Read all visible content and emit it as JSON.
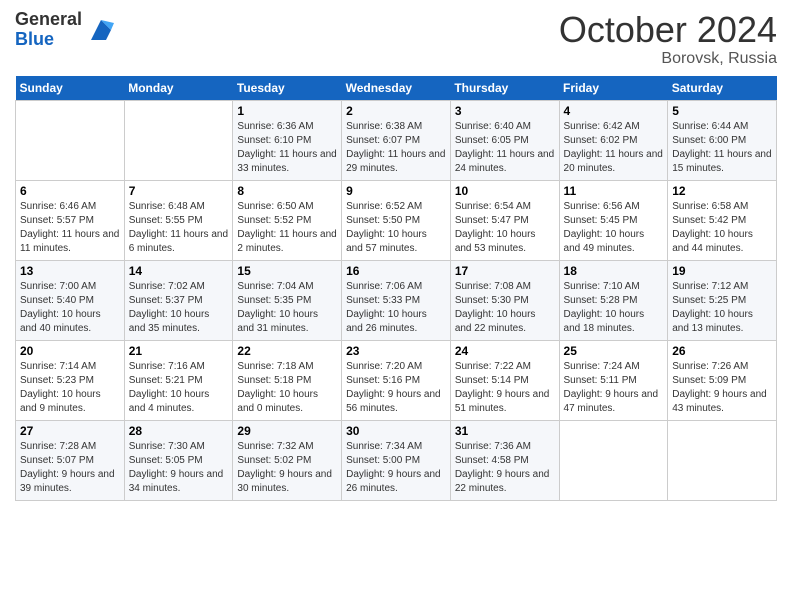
{
  "logo": {
    "line1": "General",
    "line2": "Blue"
  },
  "title": "October 2024",
  "location": "Borovsk, Russia",
  "days_header": [
    "Sunday",
    "Monday",
    "Tuesday",
    "Wednesday",
    "Thursday",
    "Friday",
    "Saturday"
  ],
  "weeks": [
    [
      {
        "num": "",
        "sunrise": "",
        "sunset": "",
        "daylight": ""
      },
      {
        "num": "",
        "sunrise": "",
        "sunset": "",
        "daylight": ""
      },
      {
        "num": "1",
        "sunrise": "Sunrise: 6:36 AM",
        "sunset": "Sunset: 6:10 PM",
        "daylight": "Daylight: 11 hours and 33 minutes."
      },
      {
        "num": "2",
        "sunrise": "Sunrise: 6:38 AM",
        "sunset": "Sunset: 6:07 PM",
        "daylight": "Daylight: 11 hours and 29 minutes."
      },
      {
        "num": "3",
        "sunrise": "Sunrise: 6:40 AM",
        "sunset": "Sunset: 6:05 PM",
        "daylight": "Daylight: 11 hours and 24 minutes."
      },
      {
        "num": "4",
        "sunrise": "Sunrise: 6:42 AM",
        "sunset": "Sunset: 6:02 PM",
        "daylight": "Daylight: 11 hours and 20 minutes."
      },
      {
        "num": "5",
        "sunrise": "Sunrise: 6:44 AM",
        "sunset": "Sunset: 6:00 PM",
        "daylight": "Daylight: 11 hours and 15 minutes."
      }
    ],
    [
      {
        "num": "6",
        "sunrise": "Sunrise: 6:46 AM",
        "sunset": "Sunset: 5:57 PM",
        "daylight": "Daylight: 11 hours and 11 minutes."
      },
      {
        "num": "7",
        "sunrise": "Sunrise: 6:48 AM",
        "sunset": "Sunset: 5:55 PM",
        "daylight": "Daylight: 11 hours and 6 minutes."
      },
      {
        "num": "8",
        "sunrise": "Sunrise: 6:50 AM",
        "sunset": "Sunset: 5:52 PM",
        "daylight": "Daylight: 11 hours and 2 minutes."
      },
      {
        "num": "9",
        "sunrise": "Sunrise: 6:52 AM",
        "sunset": "Sunset: 5:50 PM",
        "daylight": "Daylight: 10 hours and 57 minutes."
      },
      {
        "num": "10",
        "sunrise": "Sunrise: 6:54 AM",
        "sunset": "Sunset: 5:47 PM",
        "daylight": "Daylight: 10 hours and 53 minutes."
      },
      {
        "num": "11",
        "sunrise": "Sunrise: 6:56 AM",
        "sunset": "Sunset: 5:45 PM",
        "daylight": "Daylight: 10 hours and 49 minutes."
      },
      {
        "num": "12",
        "sunrise": "Sunrise: 6:58 AM",
        "sunset": "Sunset: 5:42 PM",
        "daylight": "Daylight: 10 hours and 44 minutes."
      }
    ],
    [
      {
        "num": "13",
        "sunrise": "Sunrise: 7:00 AM",
        "sunset": "Sunset: 5:40 PM",
        "daylight": "Daylight: 10 hours and 40 minutes."
      },
      {
        "num": "14",
        "sunrise": "Sunrise: 7:02 AM",
        "sunset": "Sunset: 5:37 PM",
        "daylight": "Daylight: 10 hours and 35 minutes."
      },
      {
        "num": "15",
        "sunrise": "Sunrise: 7:04 AM",
        "sunset": "Sunset: 5:35 PM",
        "daylight": "Daylight: 10 hours and 31 minutes."
      },
      {
        "num": "16",
        "sunrise": "Sunrise: 7:06 AM",
        "sunset": "Sunset: 5:33 PM",
        "daylight": "Daylight: 10 hours and 26 minutes."
      },
      {
        "num": "17",
        "sunrise": "Sunrise: 7:08 AM",
        "sunset": "Sunset: 5:30 PM",
        "daylight": "Daylight: 10 hours and 22 minutes."
      },
      {
        "num": "18",
        "sunrise": "Sunrise: 7:10 AM",
        "sunset": "Sunset: 5:28 PM",
        "daylight": "Daylight: 10 hours and 18 minutes."
      },
      {
        "num": "19",
        "sunrise": "Sunrise: 7:12 AM",
        "sunset": "Sunset: 5:25 PM",
        "daylight": "Daylight: 10 hours and 13 minutes."
      }
    ],
    [
      {
        "num": "20",
        "sunrise": "Sunrise: 7:14 AM",
        "sunset": "Sunset: 5:23 PM",
        "daylight": "Daylight: 10 hours and 9 minutes."
      },
      {
        "num": "21",
        "sunrise": "Sunrise: 7:16 AM",
        "sunset": "Sunset: 5:21 PM",
        "daylight": "Daylight: 10 hours and 4 minutes."
      },
      {
        "num": "22",
        "sunrise": "Sunrise: 7:18 AM",
        "sunset": "Sunset: 5:18 PM",
        "daylight": "Daylight: 10 hours and 0 minutes."
      },
      {
        "num": "23",
        "sunrise": "Sunrise: 7:20 AM",
        "sunset": "Sunset: 5:16 PM",
        "daylight": "Daylight: 9 hours and 56 minutes."
      },
      {
        "num": "24",
        "sunrise": "Sunrise: 7:22 AM",
        "sunset": "Sunset: 5:14 PM",
        "daylight": "Daylight: 9 hours and 51 minutes."
      },
      {
        "num": "25",
        "sunrise": "Sunrise: 7:24 AM",
        "sunset": "Sunset: 5:11 PM",
        "daylight": "Daylight: 9 hours and 47 minutes."
      },
      {
        "num": "26",
        "sunrise": "Sunrise: 7:26 AM",
        "sunset": "Sunset: 5:09 PM",
        "daylight": "Daylight: 9 hours and 43 minutes."
      }
    ],
    [
      {
        "num": "27",
        "sunrise": "Sunrise: 7:28 AM",
        "sunset": "Sunset: 5:07 PM",
        "daylight": "Daylight: 9 hours and 39 minutes."
      },
      {
        "num": "28",
        "sunrise": "Sunrise: 7:30 AM",
        "sunset": "Sunset: 5:05 PM",
        "daylight": "Daylight: 9 hours and 34 minutes."
      },
      {
        "num": "29",
        "sunrise": "Sunrise: 7:32 AM",
        "sunset": "Sunset: 5:02 PM",
        "daylight": "Daylight: 9 hours and 30 minutes."
      },
      {
        "num": "30",
        "sunrise": "Sunrise: 7:34 AM",
        "sunset": "Sunset: 5:00 PM",
        "daylight": "Daylight: 9 hours and 26 minutes."
      },
      {
        "num": "31",
        "sunrise": "Sunrise: 7:36 AM",
        "sunset": "Sunset: 4:58 PM",
        "daylight": "Daylight: 9 hours and 22 minutes."
      },
      {
        "num": "",
        "sunrise": "",
        "sunset": "",
        "daylight": ""
      },
      {
        "num": "",
        "sunrise": "",
        "sunset": "",
        "daylight": ""
      }
    ]
  ]
}
